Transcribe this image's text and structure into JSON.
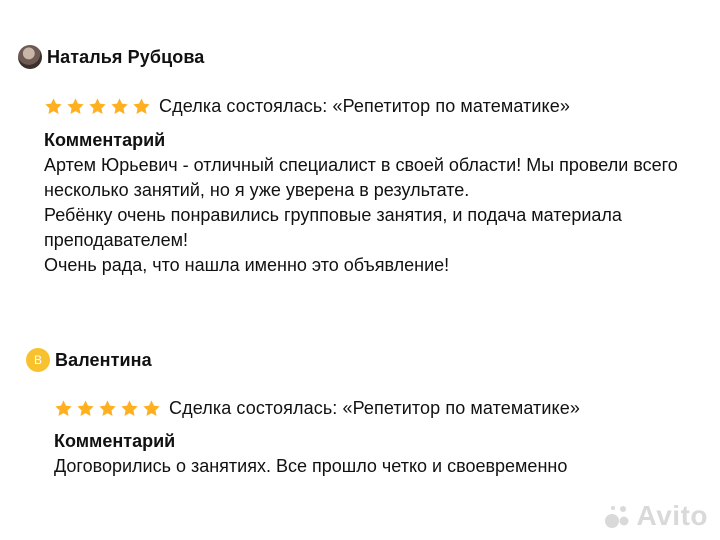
{
  "colors": {
    "star": "#FFB021",
    "avatar_letter_bg": "#F8C12E",
    "watermark": "#D9D9D9"
  },
  "reviews": [
    {
      "author": "Наталья Рубцова",
      "avatar": "photo",
      "rating": 5,
      "deal_text": "Сделка состоялась: «Репетитор по математике»",
      "comment_title": "Комментарий",
      "comment_lines": [
        "Артем Юрьевич - отличный специалист в своей области! Мы провели всего",
        "несколько занятий, но я уже уверена в результате.",
        "Ребёнку очень понравились групповые занятия, и подача материала",
        "преподавателем!",
        "Очень рада, что нашла именно это объявление!"
      ]
    },
    {
      "author": "Валентина",
      "avatar": "letter",
      "avatar_letter": "В",
      "rating": 5,
      "deal_text": "Сделка состоялась: «Репетитор по математике»",
      "comment_title": "Комментарий",
      "comment_lines": [
        "Договорились о занятиях. Все прошло четко и своевременно"
      ]
    }
  ],
  "watermark": {
    "text": "Avito",
    "icon": "avito-logo-icon"
  }
}
